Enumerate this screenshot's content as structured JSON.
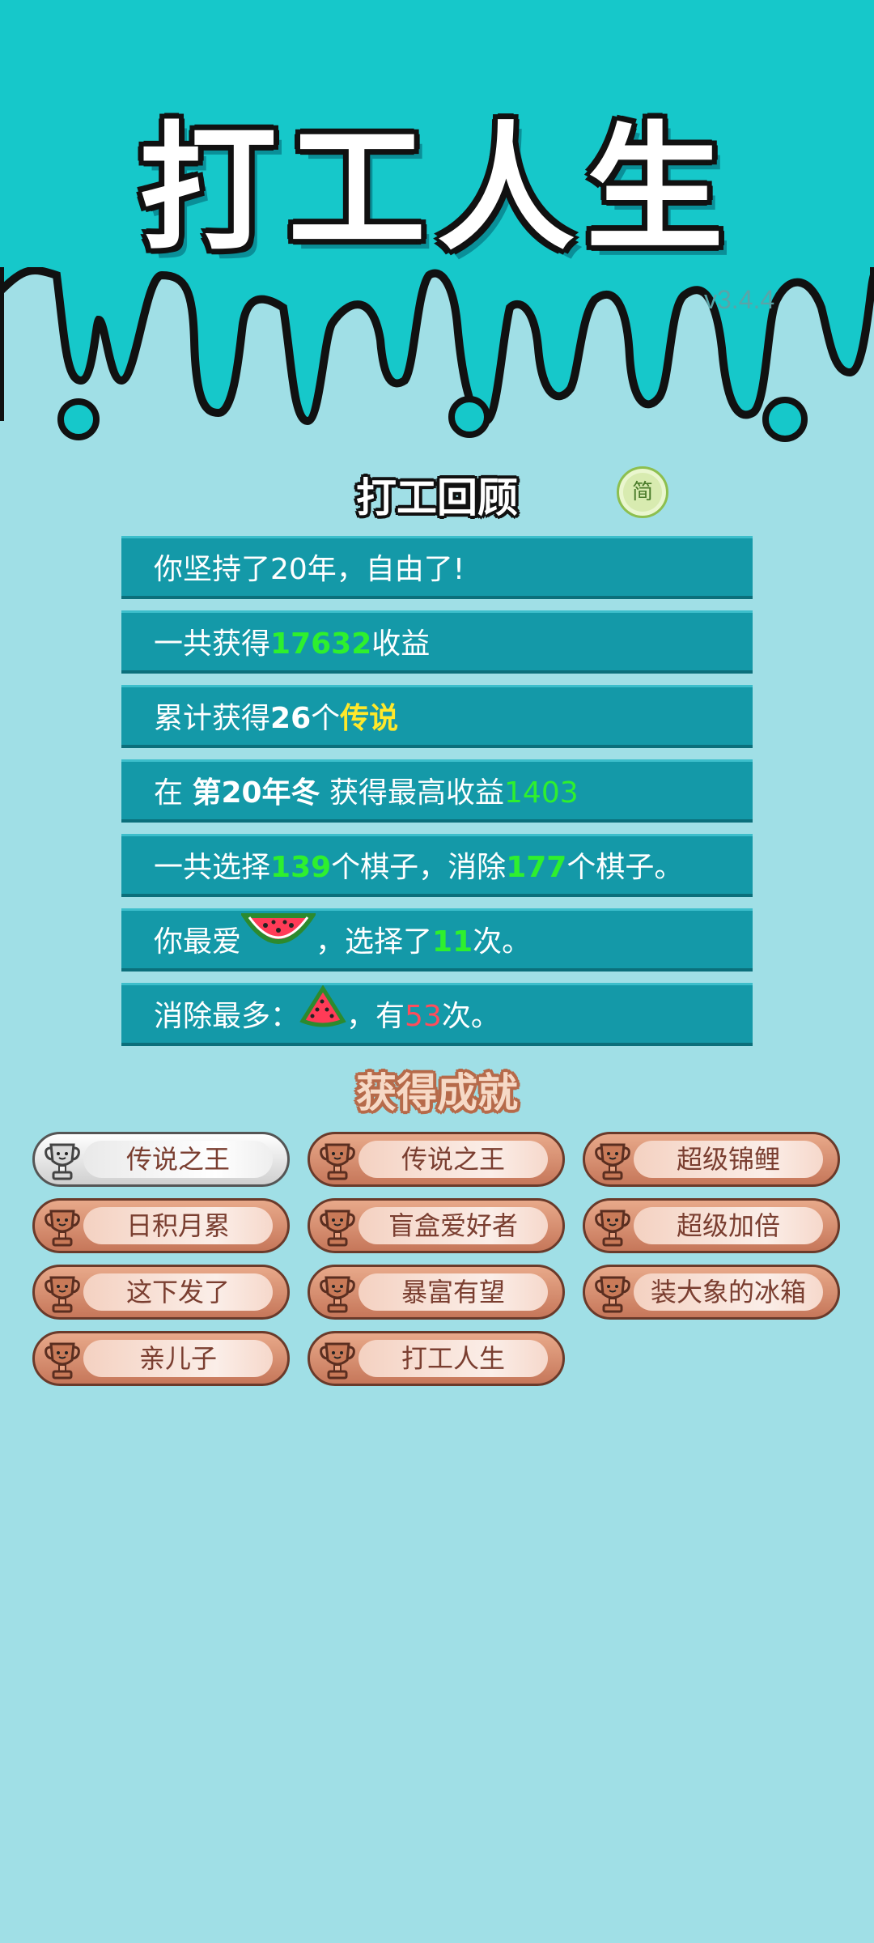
{
  "app": {
    "title": "打工人生",
    "version": "v3.4.4"
  },
  "lang_toggle": {
    "label": "简"
  },
  "review": {
    "title": "打工回顾",
    "rows": [
      {
        "segments": [
          {
            "text": "你坚持了20年，自由了!"
          }
        ]
      },
      {
        "segments": [
          {
            "text": "一共获得"
          },
          {
            "text": "17632",
            "style": "g"
          },
          {
            "text": "收益"
          }
        ]
      },
      {
        "segments": [
          {
            "text": "累计获得"
          },
          {
            "text": "26",
            "style": "b"
          },
          {
            "text": "个"
          },
          {
            "text": "传说",
            "style": "y"
          }
        ]
      },
      {
        "segments": [
          {
            "text": "在 "
          },
          {
            "text": "第20年冬",
            "style": "b"
          },
          {
            "text": " 获得最高收益"
          },
          {
            "text": "1403",
            "style": "gl"
          }
        ]
      },
      {
        "segments": [
          {
            "text": "一共选择"
          },
          {
            "text": "139",
            "style": "g"
          },
          {
            "text": "个棋子，消除"
          },
          {
            "text": "177",
            "style": "g"
          },
          {
            "text": "个棋子。"
          }
        ]
      },
      {
        "segments": [
          {
            "text": "你最爱"
          },
          {
            "icon": "watermelon-slice-icon"
          },
          {
            "text": "，选择了"
          },
          {
            "text": "11",
            "style": "g"
          },
          {
            "text": "次。"
          }
        ]
      },
      {
        "segments": [
          {
            "text": "消除最多："
          },
          {
            "icon": "watermelon-wedge-icon"
          },
          {
            "text": "，有"
          },
          {
            "text": "53",
            "style": "r"
          },
          {
            "text": "次。"
          }
        ]
      }
    ]
  },
  "achievements": {
    "title": "获得成就",
    "items": [
      {
        "label": "传说之王",
        "tier": "silver"
      },
      {
        "label": "传说之王",
        "tier": "bronze"
      },
      {
        "label": "超级锦鲤",
        "tier": "bronze"
      },
      {
        "label": "日积月累",
        "tier": "bronze"
      },
      {
        "label": "盲盒爱好者",
        "tier": "bronze"
      },
      {
        "label": "超级加倍",
        "tier": "bronze"
      },
      {
        "label": "这下发了",
        "tier": "bronze"
      },
      {
        "label": "暴富有望",
        "tier": "bronze"
      },
      {
        "label": "装大象的冰箱",
        "tier": "bronze"
      },
      {
        "label": "亲儿子",
        "tier": "bronze"
      },
      {
        "label": "打工人生",
        "tier": "bronze"
      }
    ]
  },
  "colors": {
    "header_bg": "#16c8ca",
    "page_bg": "#a0dfe6",
    "row_bg": "#1499a8",
    "highlight_green": "#2ef02e",
    "highlight_yellow": "#ffe82a",
    "highlight_red": "#ff4d5c"
  }
}
